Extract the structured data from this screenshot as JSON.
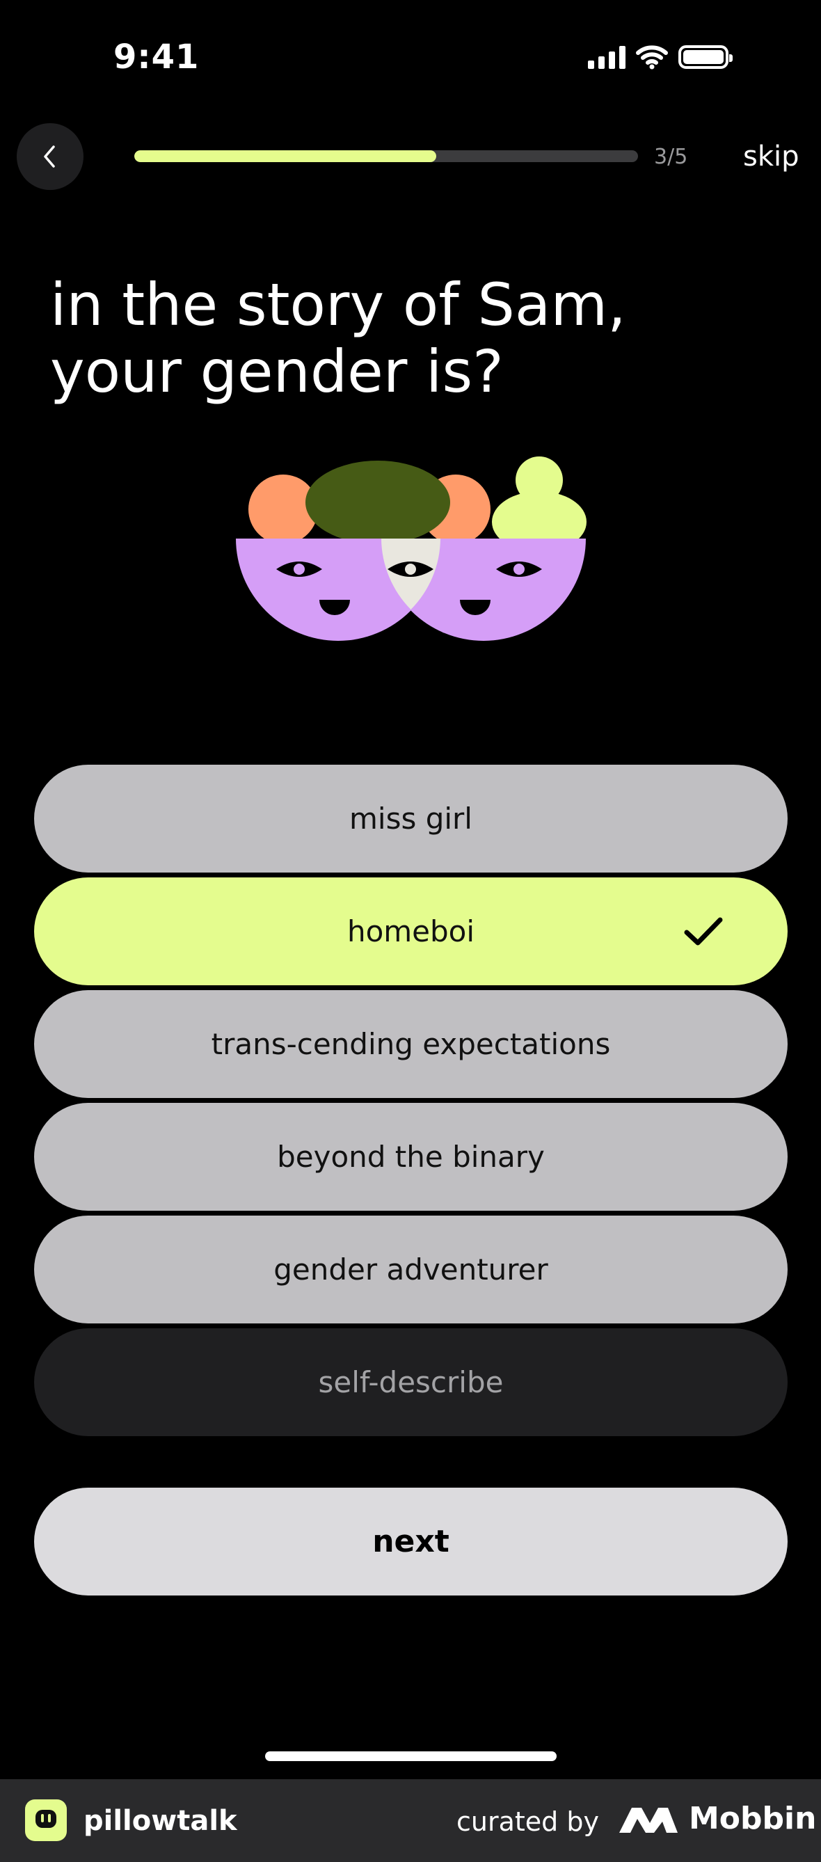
{
  "status_bar": {
    "time": "9:41"
  },
  "header": {
    "progress_fraction": 0.6,
    "counter": "3/5",
    "skip_label": "skip"
  },
  "question": {
    "line1": "in the story of Sam,",
    "line2": "your gender is?"
  },
  "options": [
    {
      "label": "miss girl",
      "selected": false
    },
    {
      "label": "homeboi",
      "selected": true
    },
    {
      "label": "trans-cending expectations",
      "selected": false
    },
    {
      "label": "beyond the binary",
      "selected": false
    },
    {
      "label": "gender adventurer",
      "selected": false
    },
    {
      "label": "self-describe",
      "selected": false
    }
  ],
  "next_label": "next",
  "footer": {
    "app_name": "pillowtalk",
    "curated_by": "curated by",
    "brand": "Mobbin"
  },
  "colors": {
    "accent": "#e4fc8e",
    "option_bg": "#c0bfc2",
    "background": "#000000"
  }
}
